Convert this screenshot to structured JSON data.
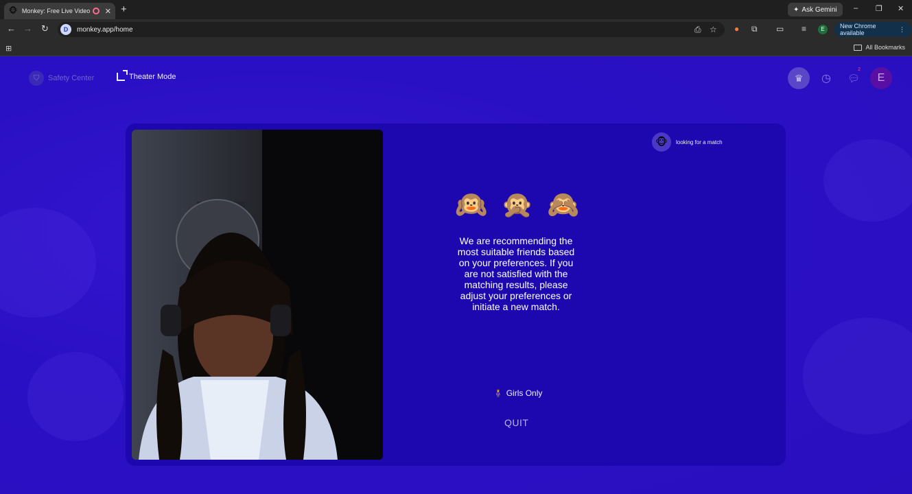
{
  "browser": {
    "tab": {
      "title": "Monkey: Free Live Video Ch",
      "favicon": "monkey-icon",
      "close_icon": "✕"
    },
    "new_tab_icon": "+",
    "ask_gemini_label": "Ask Gemini",
    "window_controls": {
      "minimize": "–",
      "restore": "❐",
      "close": "✕"
    },
    "url": "monkey.app/home",
    "new_chrome_label": "New Chrome available",
    "bookmarks_label": "All Bookmarks",
    "profile_initial": "E"
  },
  "page": {
    "safety_center_label": "Safety Center",
    "theater_mode_label": "Theater Mode",
    "chat_badge_count": "2",
    "avatar_initial": "E",
    "status": {
      "avatar_emoji": "🐵",
      "text": "looking for a match"
    },
    "monkeys": [
      "🙉",
      "🙊",
      "🙈"
    ],
    "recommendation_text": "We are recommending the most suitable friends based on your preferences. If you are not satisfied with the matching results, please adjust your preferences or initiate a new match.",
    "girls_only_icon": "🧍‍♀️",
    "girls_only_label": "Girls Only",
    "quit_label": "QUIT"
  },
  "colors": {
    "page_background": "#2a10c4",
    "stage_background": "#1d08b0",
    "browser_dark": "#1f1f1f"
  }
}
